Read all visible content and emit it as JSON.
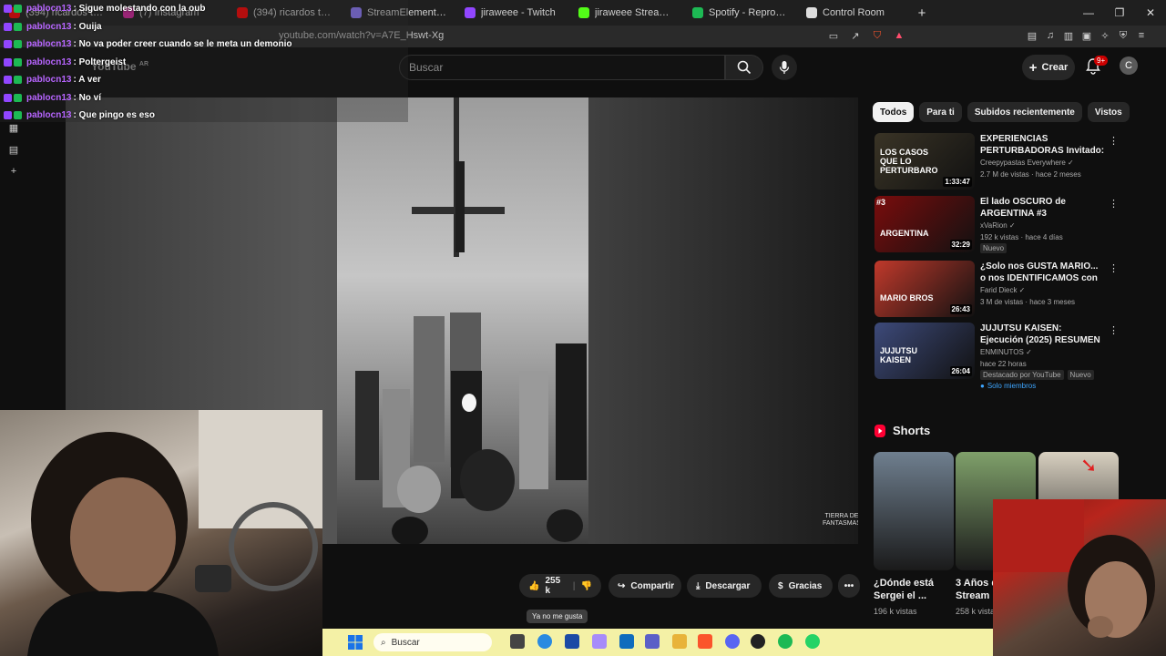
{
  "browser": {
    "tabs": [
      {
        "label": "(394) ricardos team - YouT",
        "color": "#ff0000"
      },
      {
        "label": "(7) Instagram",
        "color": "#d6249f"
      },
      {
        "label": "(394) ricardos team - YouT",
        "color": "#ff0000"
      },
      {
        "label": "StreamElements - Multi-St",
        "color": "#8f7cff"
      },
      {
        "label": "jiraweee - Twitch",
        "color": "#9146ff"
      },
      {
        "label": "jiraweee Stream - Watch L",
        "color": "#53fc18"
      },
      {
        "label": "Spotify - Reproductor web",
        "color": "#1db954"
      },
      {
        "label": "Control Room",
        "color": "#dddddd"
      }
    ],
    "new_tab": "+",
    "url": "youtube.com/watch?v=A7E_Hswt-Xg"
  },
  "youtube": {
    "logo_text": "YouTube",
    "logo_region": "AR",
    "search_placeholder": "Buscar",
    "create_label": "Crear",
    "notifications": "9+",
    "avatar_letter": "C",
    "actions": {
      "likes": "255 k",
      "share": "Compartir",
      "download": "Descargar",
      "thanks": "Gracias",
      "tooltip": "Ya no me gusta"
    },
    "chips": [
      "Todos",
      "Para ti",
      "Subidos recientemente",
      "Vistos"
    ],
    "recommendations": [
      {
        "title": "EXPERIENCIAS PERTURBADORAS Invitado: ...",
        "channel": "Creepypastas Everywhere",
        "views": "2.7 M de vistas · hace 2 meses",
        "duration": "1:33:47",
        "thumb_text": "LOS CASOS QUE LO PERTURBARO",
        "thumb_color": "#3a3426",
        "badges": []
      },
      {
        "title": "El lado OSCURO de ARGENTINA #3",
        "channel": "xVaRion",
        "views": "192 k vistas · hace 4 días",
        "duration": "32:29",
        "thumb_text": "ARGENTINA",
        "thumb_label": "#3",
        "thumb_color": "#7a0c0c",
        "badges": [
          "Nuevo"
        ]
      },
      {
        "title": "¿Solo nos GUSTA MARIO... o nos IDENTIFICAMOS con él? | ...",
        "channel": "Farid Dieck",
        "views": "3 M de vistas · hace 3 meses",
        "duration": "26:43",
        "thumb_text": "MARIO BROS",
        "thumb_color": "#c0392b",
        "badges": []
      },
      {
        "title": "JUJUTSU KAISEN: Ejecución (2025) RESUMEN EN MINUTOS",
        "channel": "ENMINUTOS",
        "views": "hace 22 horas",
        "duration": "26:04",
        "thumb_text": "JUJUTSU KAISEN",
        "thumb_color": "#3d4a7a",
        "badges": [
          "Destacado por YouTube",
          "Nuevo"
        ],
        "members": "Solo miembros"
      }
    ],
    "shorts_label": "Shorts",
    "shorts": [
      {
        "title": "¿Dónde está Sergei el ...",
        "views": "196 k vistas",
        "color": "#6f7f8f"
      },
      {
        "title": "3 Años d Stream M",
        "views": "258 k vistas",
        "color": "#7fa06a"
      },
      {
        "title": "",
        "views": "",
        "color": "#d8d0c0"
      }
    ],
    "watermark": "TIERRA DE\nFANTASMAS"
  },
  "chat": [
    {
      "user": "pablocn13",
      "msg": ": Sigue molestando con la oub"
    },
    {
      "user": "pablocn13",
      "msg": ": Ouija"
    },
    {
      "user": "pablocn13",
      "msg": ": No va poder creer cuando se le meta un demonio"
    },
    {
      "user": "pablocn13",
      "msg": ": Poltergeist"
    },
    {
      "user": "pablocn13",
      "msg": ": A ver"
    },
    {
      "user": "pablocn13",
      "msg": ": No ví"
    },
    {
      "user": "pablocn13",
      "msg": ": Que pingo es eso"
    }
  ],
  "taskbar": {
    "search_label": "Buscar"
  },
  "colors": {
    "accent": "#3ea6ff",
    "chat_user": "#b765ff",
    "brand_red": "#ff0000"
  }
}
